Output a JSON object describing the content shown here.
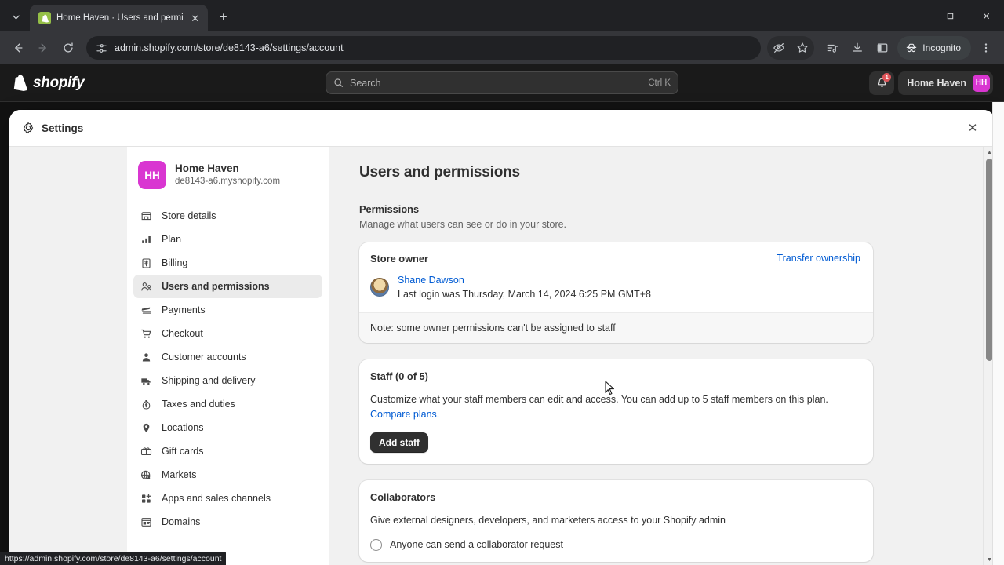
{
  "browser": {
    "tab": {
      "title": "Home Haven · Users and permi",
      "favicon": "shopify-favicon",
      "close_label": "✕"
    },
    "newtab_label": "+",
    "tabstrip_chevron": "⌄",
    "window_controls": {
      "minimize": "—",
      "maximize": "❐",
      "close": "✕"
    },
    "nav": {
      "back": "←",
      "forward": "→",
      "reload": "⟳"
    },
    "omnibox": {
      "url": "admin.shopify.com/store/de8143-a6/settings/account",
      "site_settings_icon": "tune-icon"
    },
    "toolbar_icons": [
      "eye-off-icon",
      "star-icon",
      "playlist-icon",
      "download-icon",
      "side-panel-icon"
    ],
    "incognito": {
      "label": "Incognito",
      "icon": "incognito-icon"
    },
    "menu_icon": "three-dot-menu-icon",
    "status_url": "https://admin.shopify.com/store/de8143-a6/settings/account"
  },
  "shopify_header": {
    "logo_text": "shopify",
    "search": {
      "placeholder": "Search",
      "shortcut": "Ctrl K",
      "icon": "search-icon"
    },
    "notifications": {
      "icon": "bell-icon",
      "count": "1"
    },
    "store": {
      "name": "Home Haven",
      "initials": "HH"
    }
  },
  "modal": {
    "title": "Settings",
    "gear_icon": "gear-icon",
    "close_label": "✕"
  },
  "sidebar": {
    "store": {
      "initials": "HH",
      "name": "Home Haven",
      "domain": "de8143-a6.myshopify.com"
    },
    "items": [
      {
        "label": "Store details",
        "icon": "store-icon",
        "active": false
      },
      {
        "label": "Plan",
        "icon": "chart-icon",
        "active": false
      },
      {
        "label": "Billing",
        "icon": "billing-icon",
        "active": false
      },
      {
        "label": "Users and permissions",
        "icon": "users-icon",
        "active": true
      },
      {
        "label": "Payments",
        "icon": "payments-icon",
        "active": false
      },
      {
        "label": "Checkout",
        "icon": "cart-icon",
        "active": false
      },
      {
        "label": "Customer accounts",
        "icon": "person-icon",
        "active": false
      },
      {
        "label": "Shipping and delivery",
        "icon": "truck-icon",
        "active": false
      },
      {
        "label": "Taxes and duties",
        "icon": "tax-icon",
        "active": false
      },
      {
        "label": "Locations",
        "icon": "pin-icon",
        "active": false
      },
      {
        "label": "Gift cards",
        "icon": "gift-card-icon",
        "active": false
      },
      {
        "label": "Markets",
        "icon": "globe-icon",
        "active": false
      },
      {
        "label": "Apps and sales channels",
        "icon": "apps-icon",
        "active": false
      },
      {
        "label": "Domains",
        "icon": "domains-icon",
        "active": false
      }
    ]
  },
  "main": {
    "page_title": "Users and permissions",
    "permissions": {
      "heading": "Permissions",
      "description": "Manage what users can see or do in your store."
    },
    "store_owner_card": {
      "heading": "Store owner",
      "transfer_link": "Transfer ownership",
      "owner_name": "Shane Dawson",
      "last_login": "Last login was Thursday, March 14, 2024 6:25 PM GMT+8",
      "note": "Note: some owner permissions can't be assigned to staff"
    },
    "staff_card": {
      "heading": "Staff (0 of 5)",
      "description": "Customize what your staff members can edit and access. You can add up to 5 staff members on this plan.",
      "compare_link": "Compare plans.",
      "add_button": "Add staff"
    },
    "collaborators_card": {
      "heading": "Collaborators",
      "description": "Give external designers, developers, and marketers access to your Shopify admin",
      "option_label": "Anyone can send a collaborator request"
    }
  },
  "colors": {
    "brand_magenta": "#d936d1",
    "link_blue": "#005bd3",
    "dark_button": "#303030",
    "badge_red": "#e0565b",
    "favicon_green": "#95bf47"
  }
}
